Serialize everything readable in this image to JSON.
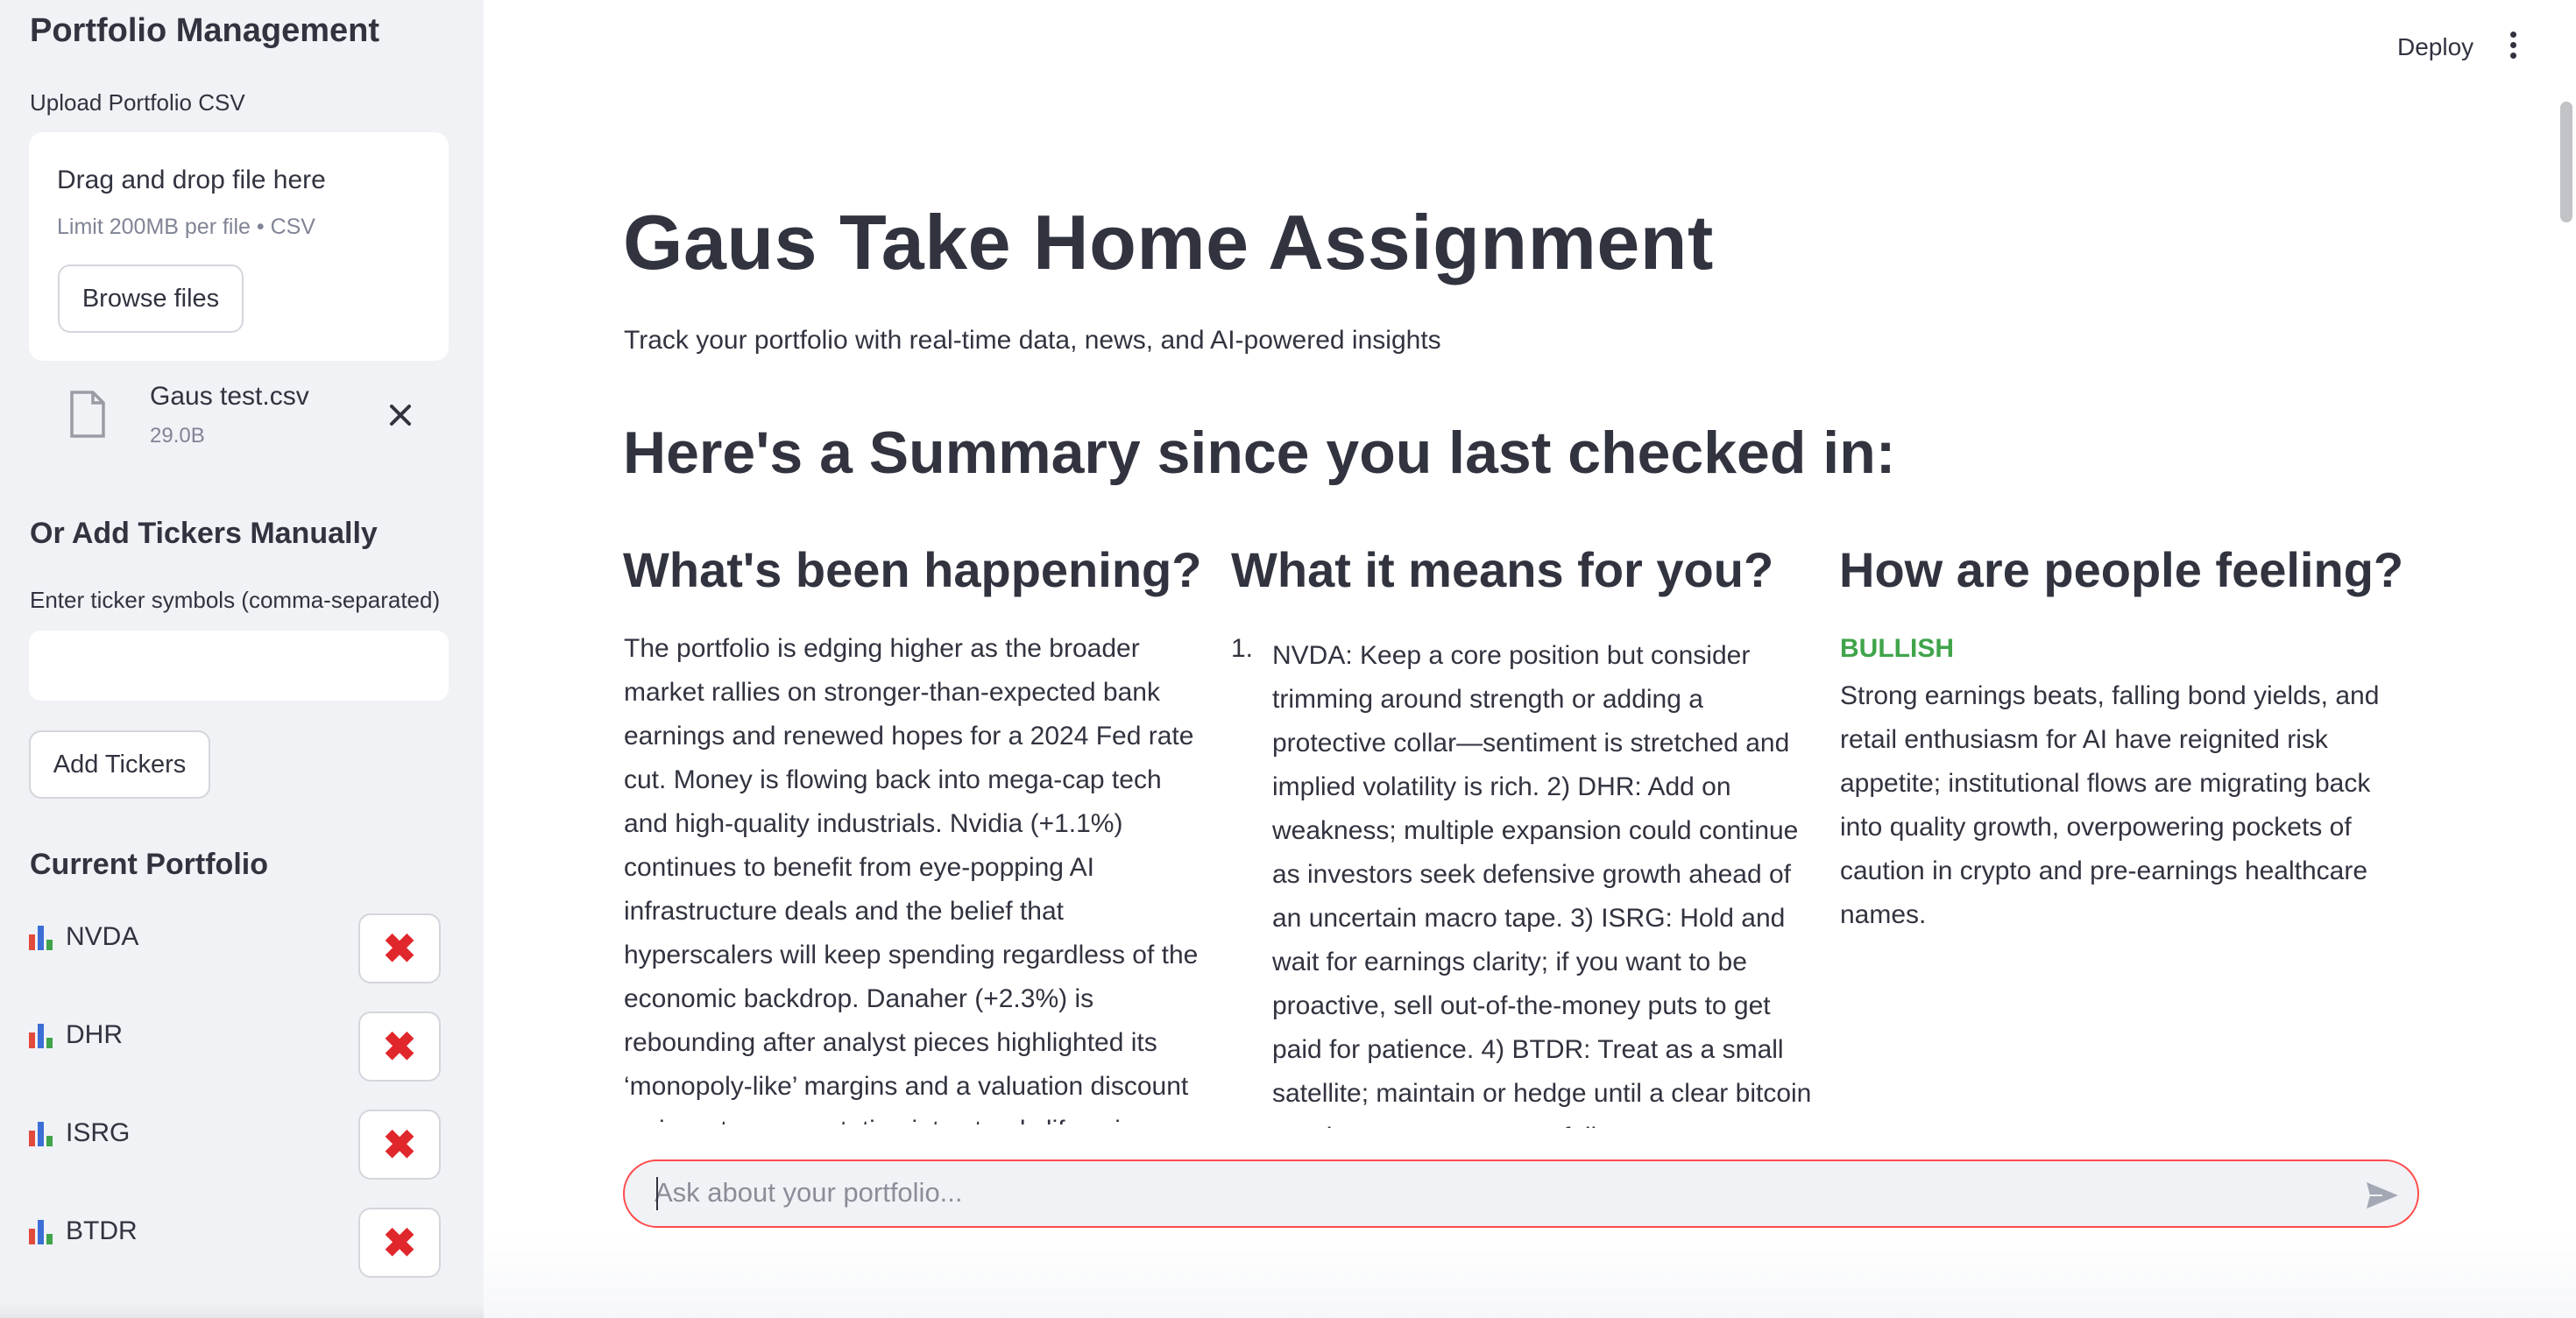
{
  "sidebar": {
    "title": "Portfolio Management",
    "upload_label": "Upload Portfolio CSV",
    "dropzone_title": "Drag and drop file here",
    "dropzone_limit": "Limit 200MB per file • CSV",
    "browse_label": "Browse files",
    "file": {
      "name": "Gaus test.csv",
      "size": "29.0B",
      "icon": "file-icon",
      "close_icon": "close-icon"
    },
    "manual_heading": "Or Add Tickers Manually",
    "ticker_input_label": "Enter ticker symbols (comma-separated)",
    "ticker_input_value": "",
    "add_tickers_label": "Add Tickers",
    "portfolio_heading": "Current Portfolio",
    "tickers": [
      {
        "symbol": "NVDA",
        "icon": "bar-chart-icon",
        "remove_icon": "cross-mark-icon"
      },
      {
        "symbol": "DHR",
        "icon": "bar-chart-icon",
        "remove_icon": "cross-mark-icon"
      },
      {
        "symbol": "ISRG",
        "icon": "bar-chart-icon",
        "remove_icon": "cross-mark-icon"
      },
      {
        "symbol": "BTDR",
        "icon": "bar-chart-icon",
        "remove_icon": "cross-mark-icon"
      }
    ]
  },
  "header": {
    "deploy_label": "Deploy",
    "menu_icon": "kebab-menu-icon"
  },
  "main": {
    "title": "Gaus Take Home Assignment",
    "subtitle": "Track your portfolio with real-time data, news, and AI-powered insights",
    "summary_heading": "Here's a Summary since you last checked in:",
    "columns": [
      {
        "heading": "What's been happening?",
        "body": "The portfolio is edging higher as the broader market rallies on stronger-than-expected bank earnings and renewed hopes for a 2024 Fed rate cut. Money is flowing back into mega-cap tech and high-quality industrials. Nvidia (+1.1%) continues to benefit from eye-popping AI infrastructure deals and the belief that hyperscalers will keep spending regardless of the economic backdrop. Danaher (+2.3%) is rebounding after analyst pieces highlighted its ‘monopoly-like’ margins and a valuation discount as investors are rotating into steady life-science"
      },
      {
        "heading": "What it means for you?",
        "list_number": "1.",
        "body": "NVDA: Keep a core position but consider trimming around strength or adding a protective collar—sentiment is stretched and implied volatility is rich. 2) DHR: Add on weakness; multiple expansion could continue as investors seek defensive growth ahead of an uncertain macro tape. 3) ISRG: Hold and wait for earnings clarity; if you want to be proactive, sell out-of-the-money puts to get paid for patience. 4) BTDR: Treat as a small satellite; maintain or hedge until a clear bitcoin trend emerges as crypto follows"
      },
      {
        "heading": "How are people feeling?",
        "sentiment": "BULLISH",
        "sentiment_color": "#3fa44a",
        "body": "Strong earnings beats, falling bond yields, and retail enthusiasm for AI have reignited risk appetite; institutional flows are migrating back into quality growth, overpowering pockets of caution in crypto and pre-earnings healthcare names."
      }
    ]
  },
  "chat": {
    "placeholder": "Ask about your portfolio...",
    "send_icon": "send-icon",
    "accent_color": "#ff4b4b"
  }
}
